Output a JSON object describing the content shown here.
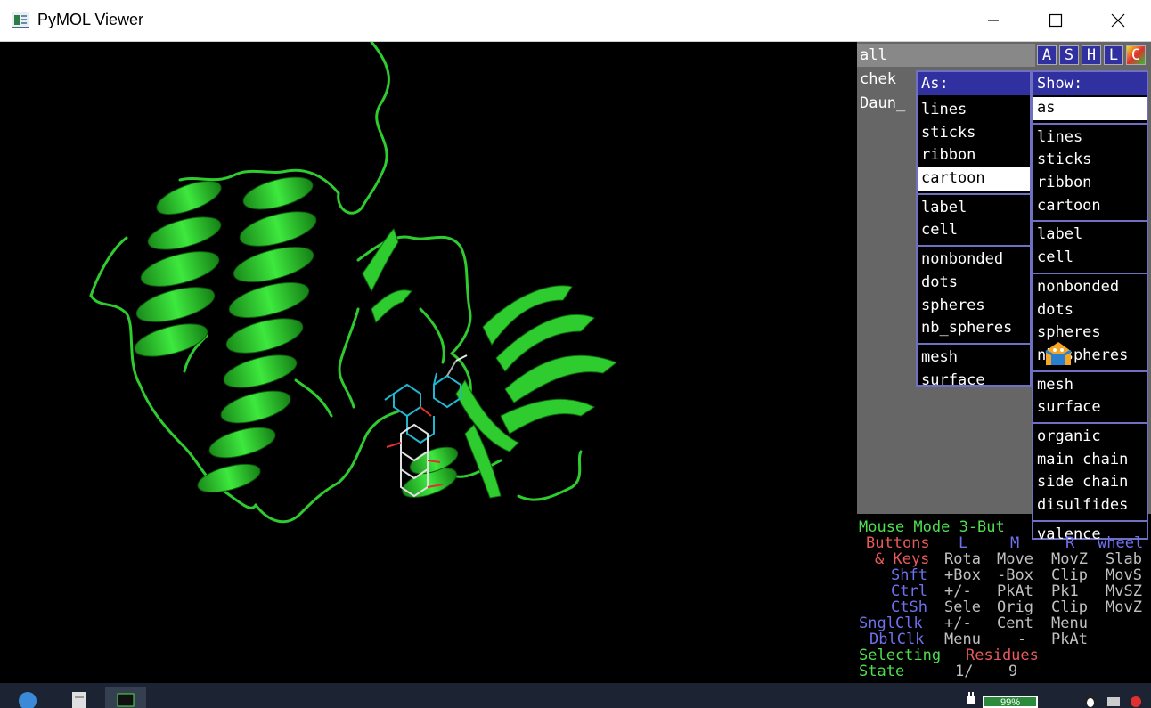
{
  "window": {
    "title": "PyMOL Viewer",
    "minimize": "—",
    "maximize": "☐",
    "close": "✕"
  },
  "objects": [
    {
      "name": "all"
    },
    {
      "name": "chek"
    },
    {
      "name": "Daun_"
    }
  ],
  "object_buttons": [
    "A",
    "S",
    "H",
    "L",
    "C"
  ],
  "menu_as": {
    "header": "As:",
    "groups": [
      [
        "lines",
        "sticks",
        "ribbon",
        "cartoon"
      ],
      [
        "label",
        "cell"
      ],
      [
        "nonbonded",
        "dots",
        "spheres",
        "nb_spheres"
      ],
      [
        "mesh",
        "surface"
      ]
    ],
    "highlighted": "cartoon"
  },
  "menu_show": {
    "header": "Show:",
    "groups": [
      [
        "as"
      ],
      [
        "lines",
        "sticks",
        "ribbon",
        "cartoon"
      ],
      [
        "label",
        "cell"
      ],
      [
        "nonbonded",
        "dots",
        "spheres",
        "nb_spheres"
      ],
      [
        "mesh",
        "surface"
      ],
      [
        "organic",
        "main chain",
        "side chain",
        "disulfides"
      ],
      [
        "valence"
      ]
    ],
    "highlighted": "as"
  },
  "mouse_panel": {
    "mode": "Mouse Mode 3-But",
    "buttons_label": "Buttons",
    "col_L": "L",
    "col_M": "M",
    "col_R": "R",
    "col_wheel": "wheel",
    "keys_label": "& Keys",
    "rows": [
      {
        "key": "",
        "L": "Rota",
        "M": "Move",
        "R": "MovZ",
        "W": "Slab"
      },
      {
        "key": "Shft",
        "L": "+Box",
        "M": "-Box",
        "R": "Clip",
        "W": "MovS"
      },
      {
        "key": "Ctrl",
        "L": "+/-",
        "M": "PkAt",
        "R": "Pk1",
        "W": "MvSZ"
      },
      {
        "key": "CtSh",
        "L": "Sele",
        "M": "Orig",
        "R": "Clip",
        "W": "MovZ"
      },
      {
        "key": "SnglClk",
        "L": "+/-",
        "M": "Cent",
        "R": "Menu",
        "W": ""
      },
      {
        "key": "DblClk",
        "L": "Menu",
        "M": "-",
        "R": "PkAt",
        "W": ""
      }
    ],
    "selecting_label": "Selecting",
    "selecting_value": "Residues",
    "state_label": "State",
    "state_value": "1/",
    "state_total": "9"
  },
  "taskbar": {
    "battery": "99%"
  },
  "colors": {
    "protein": "#2ecc2e",
    "ligand_carbon_cyan": "#22b5d0",
    "ligand_carbon_white": "#e0e0e0",
    "oxygen": "#e03030",
    "menu_border": "#7070c0"
  }
}
